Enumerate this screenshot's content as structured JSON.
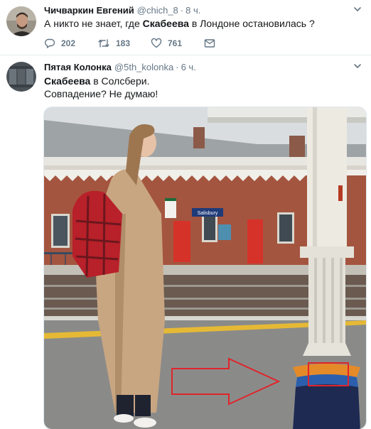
{
  "tweet1": {
    "author_name": "Чичваркин Евгений",
    "handle": "@chich_8",
    "separator": "·",
    "time": "8 ч.",
    "text_before": "А никто не знает, где ",
    "text_bold": "Скабеева",
    "text_after": " в Лондоне остановилась ?",
    "replies": "202",
    "retweets": "183",
    "likes": "761"
  },
  "tweet2": {
    "author_name": "Пятая Колонка",
    "handle": "@5th_kolonka",
    "separator": "·",
    "time": "6 ч.",
    "line1_bold": "Скабеева",
    "line1_after": " в Солсбери.",
    "line2": "Совпадение? Не думаю!",
    "station_sign": "Salisbury"
  },
  "icons": {
    "caret": "chevron-down-icon",
    "reply": "reply-icon",
    "retweet": "retweet-icon",
    "like": "heart-icon",
    "dm": "envelope-icon"
  },
  "colors": {
    "text": "#14171a",
    "secondary": "#657786",
    "divider": "#e6ecf0",
    "annotation_red": "#e0242a"
  }
}
